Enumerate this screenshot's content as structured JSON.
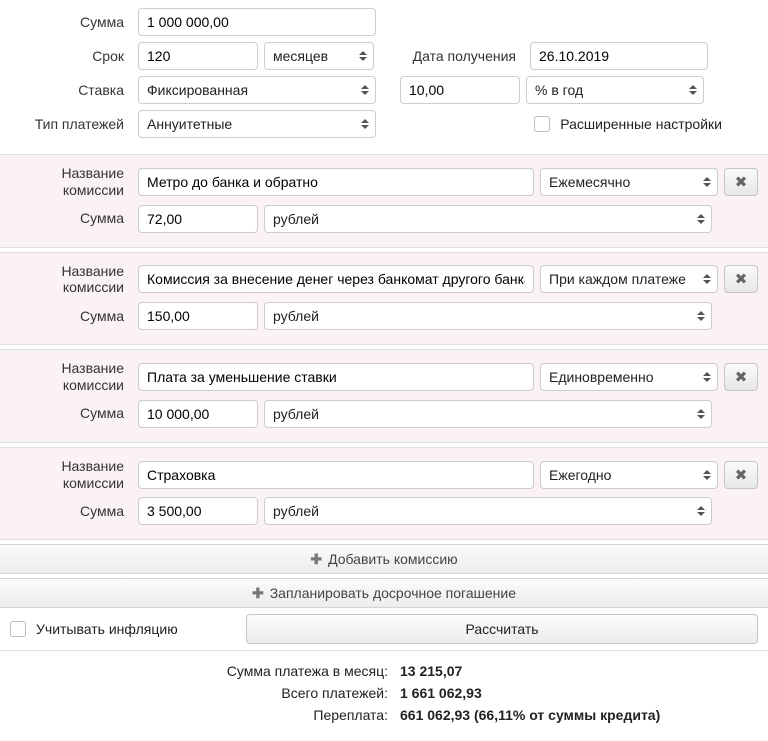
{
  "labels": {
    "amount": "Сумма",
    "term": "Срок",
    "date_received": "Дата получения",
    "rate": "Ставка",
    "payment_type": "Тип платежей",
    "advanced": "Расширенные настройки",
    "commission_name": "Название комиссии",
    "commission_amount": "Сумма",
    "add_commission": "Добавить комиссию",
    "plan_early": "Запланировать досрочное погашение",
    "consider_inflation": "Учитывать инфляцию",
    "calculate": "Рассчитать"
  },
  "values": {
    "amount": "1 000 000,00",
    "term": "120",
    "term_unit": "месяцев",
    "date": "26.10.2019",
    "rate_type": "Фиксированная",
    "rate_value": "10,00",
    "rate_unit": "% в год",
    "payment_type": "Аннуитетные"
  },
  "commissions": [
    {
      "name": "Метро до банка и обратно",
      "freq": "Ежемесячно",
      "amount": "72,00",
      "unit": "рублей"
    },
    {
      "name": "Комиссия за внесение денег через банкомат другого банка",
      "freq": "При каждом платеже",
      "amount": "150,00",
      "unit": "рублей"
    },
    {
      "name": "Плата за уменьшение ставки",
      "freq": "Единовременно",
      "amount": "10 000,00",
      "unit": "рублей"
    },
    {
      "name": "Страховка",
      "freq": "Ежегодно",
      "amount": "3 500,00",
      "unit": "рублей"
    }
  ],
  "results": {
    "monthly_label": "Сумма платежа в месяц:",
    "monthly_value": "13 215,07",
    "total_label": "Всего платежей:",
    "total_value": "1 661 062,93",
    "overpay_label": "Переплата:",
    "overpay_value": "661 062,93 (66,11% от суммы кредита)"
  }
}
